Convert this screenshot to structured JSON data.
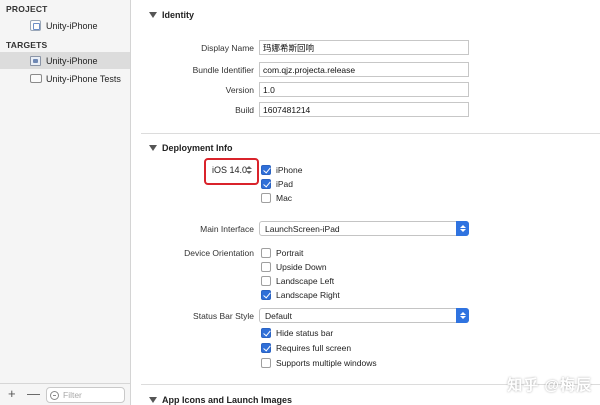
{
  "sidebar": {
    "project_heading": "PROJECT",
    "project_item": "Unity-iPhone",
    "targets_heading": "TARGETS",
    "targets": [
      "Unity-iPhone",
      "Unity-iPhone Tests"
    ],
    "filter_placeholder": "Filter",
    "add_label": "+",
    "remove_label": "—"
  },
  "identity": {
    "title": "Identity",
    "display_name_label": "Display Name",
    "display_name": "玛娜希斯回响",
    "bundle_id_label": "Bundle Identifier",
    "bundle_id": "com.qjz.projecta.release",
    "version_label": "Version",
    "version": "1.0",
    "build_label": "Build",
    "build": "1607481214"
  },
  "deployment": {
    "title": "Deployment Info",
    "ios_version": "iOS 14.0",
    "devices": [
      {
        "label": "iPhone",
        "checked": true
      },
      {
        "label": "iPad",
        "checked": true
      },
      {
        "label": "Mac",
        "checked": false
      }
    ],
    "main_interface_label": "Main Interface",
    "main_interface": "LaunchScreen-iPad",
    "orientation_label": "Device Orientation",
    "orientations": [
      {
        "label": "Portrait",
        "checked": false
      },
      {
        "label": "Upside Down",
        "checked": false
      },
      {
        "label": "Landscape Left",
        "checked": false
      },
      {
        "label": "Landscape Right",
        "checked": true
      }
    ],
    "status_bar_label": "Status Bar Style",
    "status_bar": "Default",
    "status_options": [
      {
        "label": "Hide status bar",
        "checked": true
      },
      {
        "label": "Requires full screen",
        "checked": true
      },
      {
        "label": "Supports multiple windows",
        "checked": false
      }
    ]
  },
  "app_icons": {
    "title": "App Icons and Launch Images"
  },
  "watermark": "知乎 @梅辰",
  "colors": {
    "accent": "#2f73e0",
    "highlight": "#d9232b"
  }
}
